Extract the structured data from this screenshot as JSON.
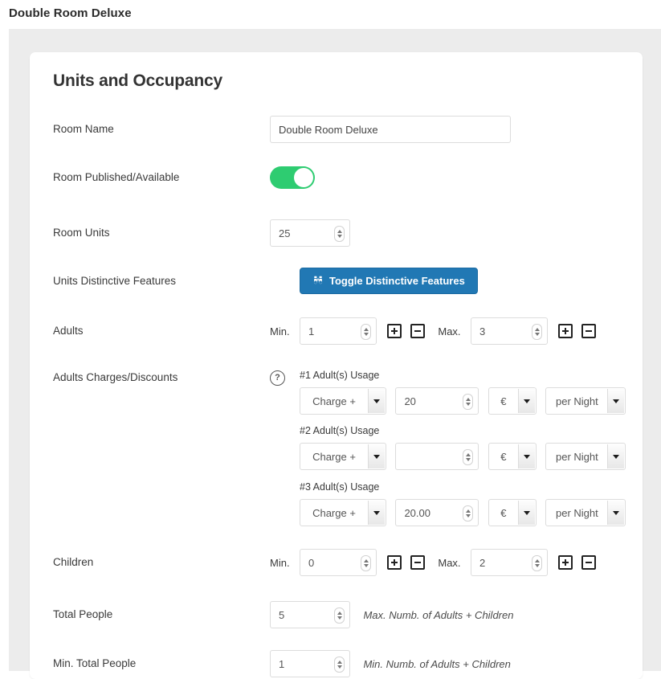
{
  "topbar": {
    "title": "Double Room Deluxe"
  },
  "card": {
    "title": "Units and Occupancy"
  },
  "fields": {
    "room_name": {
      "label": "Room Name",
      "value": "Double Room Deluxe"
    },
    "room_published": {
      "label": "Room Published/Available",
      "state": "on"
    },
    "room_units": {
      "label": "Room Units",
      "value": "25"
    },
    "distinctive_features": {
      "label": "Units Distinctive Features",
      "button_label": "Toggle Distinctive Features",
      "button_icon": "binoculars-icon",
      "button_color": "#2178b4"
    },
    "adults": {
      "label": "Adults",
      "min_label": "Min.",
      "min_value": "1",
      "max_label": "Max.",
      "max_value": "3",
      "plus_label": "+",
      "minus_label": "−"
    },
    "adults_charges": {
      "label": "Adults Charges/Discounts",
      "help_icon": "?",
      "rows": [
        {
          "usage_label": "#1 Adult(s) Usage",
          "type": "Charge +",
          "amount": "20",
          "currency": "€",
          "period": "per Night"
        },
        {
          "usage_label": "#2 Adult(s) Usage",
          "type": "Charge +",
          "amount": "",
          "currency": "€",
          "period": "per Night"
        },
        {
          "usage_label": "#3 Adult(s) Usage",
          "type": "Charge +",
          "amount": "20.00",
          "currency": "€",
          "period": "per Night"
        }
      ]
    },
    "children": {
      "label": "Children",
      "min_label": "Min.",
      "min_value": "0",
      "max_label": "Max.",
      "max_value": "2"
    },
    "total_people": {
      "label": "Total People",
      "value": "5",
      "hint": "Max. Numb. of Adults + Children"
    },
    "min_total_people": {
      "label": "Min. Total People",
      "value": "1",
      "hint": "Min. Numb. of Adults + Children"
    }
  },
  "colors": {
    "toggle_on": "#2ecc71",
    "primary": "#2178b4",
    "canvas": "#ececec",
    "card": "#ffffff"
  }
}
